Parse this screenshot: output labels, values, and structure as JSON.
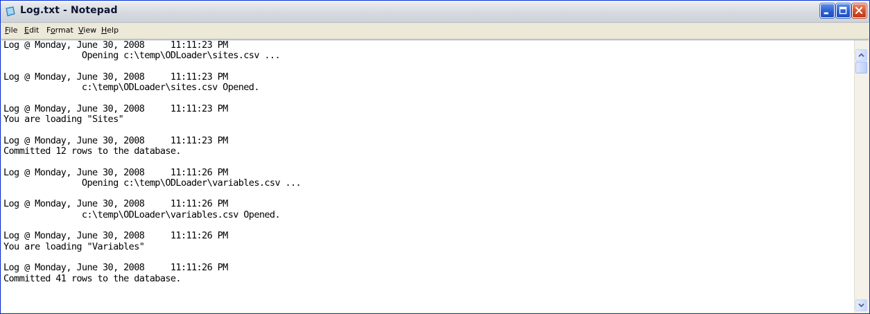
{
  "window": {
    "title": "Log.txt - Notepad",
    "caption_buttons": [
      "minimize",
      "maximize",
      "close"
    ],
    "app_icon": "notepad-icon"
  },
  "menu": {
    "items": [
      {
        "label_ul": "F",
        "label_rest": "ile"
      },
      {
        "label_ul": "E",
        "label_rest": "dit"
      },
      {
        "label_pre": "F",
        "label_ul": "o",
        "label_rest": "rmat"
      },
      {
        "label_ul": "V",
        "label_rest": "iew"
      },
      {
        "label_ul": "H",
        "label_rest": "elp"
      }
    ]
  },
  "document": {
    "text": "Log @ Monday, June 30, 2008     11:11:23 PM\n               Opening c:\\temp\\ODLoader\\sites.csv ...\n\nLog @ Monday, June 30, 2008     11:11:23 PM\n               c:\\temp\\ODLoader\\sites.csv Opened.\n\nLog @ Monday, June 30, 2008     11:11:23 PM\nYou are loading \"Sites\"\n\nLog @ Monday, June 30, 2008     11:11:23 PM\nCommitted 12 rows to the database.\n\nLog @ Monday, June 30, 2008     11:11:26 PM\n               Opening c:\\temp\\ODLoader\\variables.csv ...\n\nLog @ Monday, June 30, 2008     11:11:26 PM\n               c:\\temp\\ODLoader\\variables.csv Opened.\n\nLog @ Monday, June 30, 2008     11:11:26 PM\nYou are loading \"Variables\"\n\nLog @ Monday, June 30, 2008     11:11:26 PM\nCommitted 41 rows to the database.\n"
  },
  "scrollbar": {
    "position_fraction": 0.0
  },
  "colors": {
    "title_text": "#0c1533",
    "close_button": "#d2502b",
    "caption_button": "#2a5fd3",
    "menu_bg": "#ece9d8"
  }
}
